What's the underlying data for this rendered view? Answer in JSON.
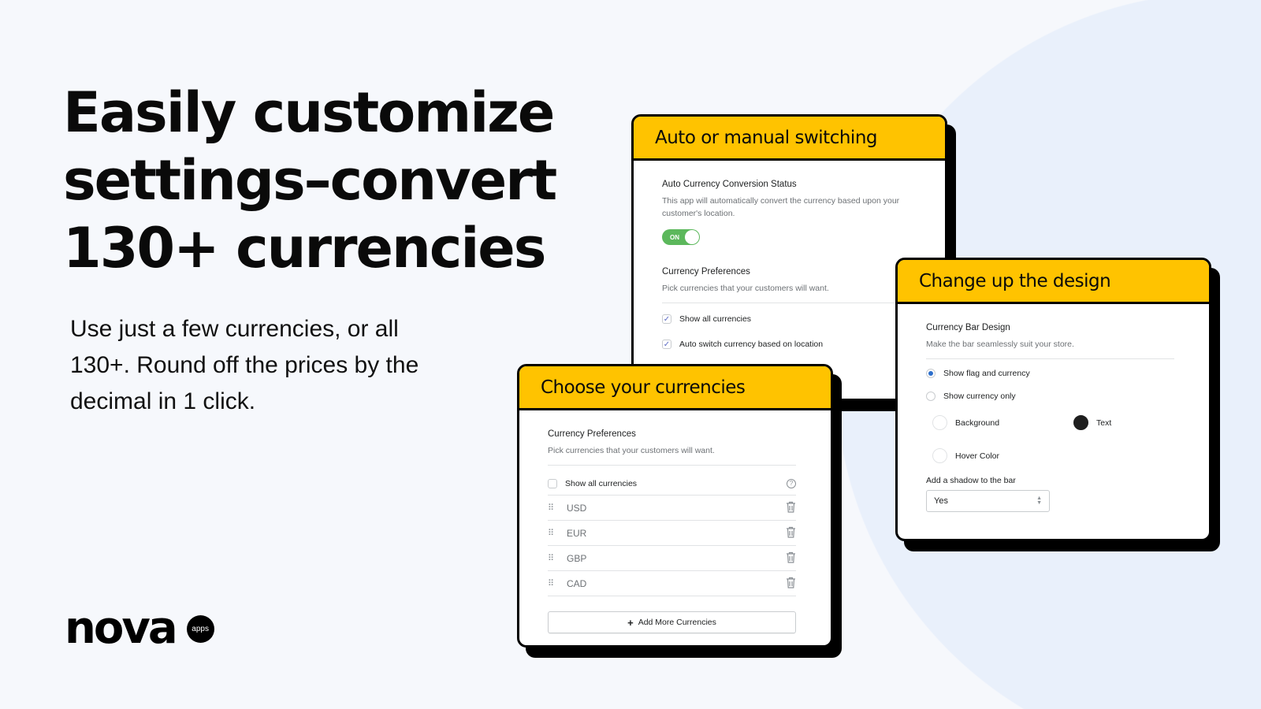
{
  "colors": {
    "accent": "#ffc300",
    "toggle_on": "#5cb85c",
    "radio_selected": "#2c6ecb",
    "background": "#f6f8fc"
  },
  "headline": [
    "Easily customize",
    "settings–convert",
    "130+ currencies"
  ],
  "subtext": "Use just a few currencies, or all 130+. Round off the prices by the decimal in 1 click.",
  "logo": {
    "word": "nova",
    "badge": "apps"
  },
  "card_switching": {
    "title": "Auto or manual switching",
    "status_title": "Auto Currency Conversion Status",
    "status_desc": "This app will automatically convert the currency based upon your customer's location.",
    "toggle_label": "ON",
    "toggle_on": true,
    "prefs_title": "Currency Preferences",
    "prefs_desc": "Pick currencies that your customers will want.",
    "options": [
      {
        "label": "Show all currencies",
        "checked": true
      },
      {
        "label": "Auto switch currency based on location",
        "checked": true
      }
    ]
  },
  "card_currencies": {
    "title": "Choose your currencies",
    "prefs_title": "Currency Preferences",
    "prefs_desc": "Pick currencies that your customers will want.",
    "show_all_label": "Show all currencies",
    "show_all_checked": false,
    "currencies": [
      "USD",
      "EUR",
      "GBP",
      "CAD"
    ],
    "add_button": "Add More Currencies"
  },
  "card_design": {
    "title": "Change up the design",
    "section_title": "Currency Bar Design",
    "section_desc": "Make the bar seamlessly suit your store.",
    "radio_options": [
      {
        "label": "Show flag and currency",
        "selected": true
      },
      {
        "label": "Show currency only",
        "selected": false
      }
    ],
    "colors": {
      "background_label": "Background",
      "text_label": "Text",
      "hover_label": "Hover Color",
      "background_value": "#ffffff",
      "text_value": "#1f1f1f",
      "hover_value": "#ffffff"
    },
    "shadow_label": "Add a shadow to the bar",
    "shadow_value": "Yes"
  }
}
